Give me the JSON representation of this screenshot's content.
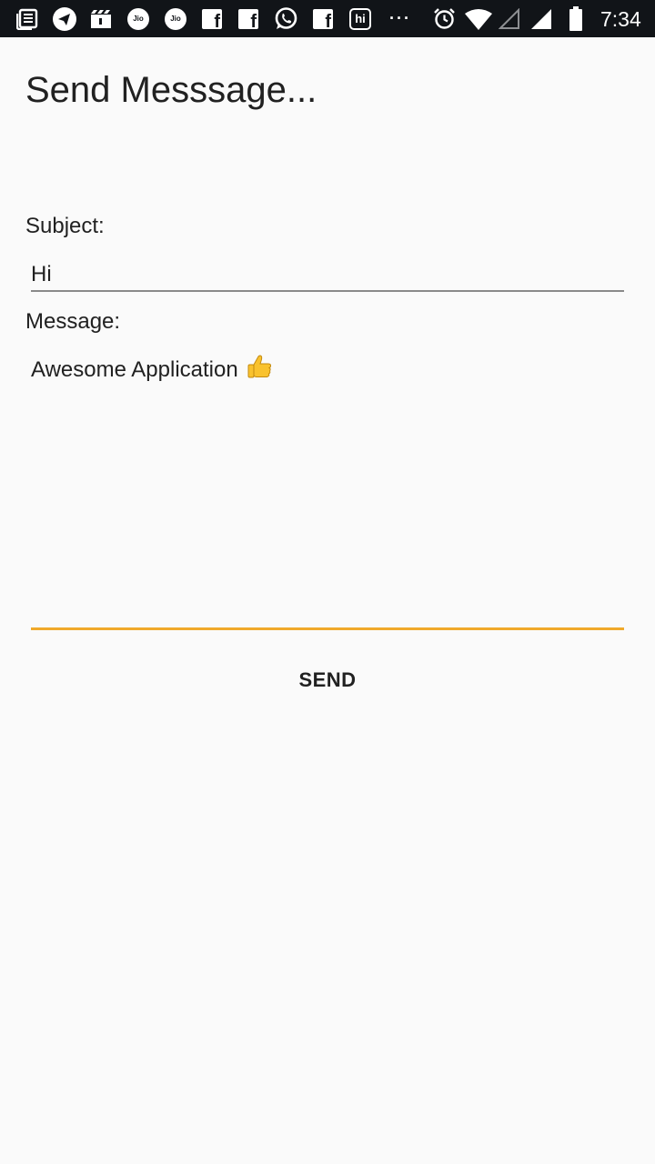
{
  "status_bar": {
    "time": "7:34",
    "jio_label": "Jio",
    "hi_label": "hi",
    "fb_letter": "f",
    "more": "···",
    "icons": [
      "news-icon",
      "telegram-icon",
      "clapper-icon",
      "jio-icon",
      "jio-icon",
      "facebook-icon",
      "facebook-icon",
      "whatsapp-icon",
      "facebook-icon",
      "hike-icon",
      "more-icon",
      "alarm-icon",
      "wifi-icon",
      "signal-empty-icon",
      "signal-full-icon",
      "battery-icon"
    ]
  },
  "page": {
    "title": "Send Messsage..."
  },
  "form": {
    "subject_label": "Subject:",
    "subject_value": "Hi",
    "message_label": "Message:",
    "message_value": "Awesome Application",
    "message_emoji": "thumbs-up-icon",
    "send_label": "SEND"
  },
  "colors": {
    "status_bar_bg": "#111418",
    "background": "#fafafa",
    "accent_underline": "#f0a92a",
    "text": "#212121"
  }
}
